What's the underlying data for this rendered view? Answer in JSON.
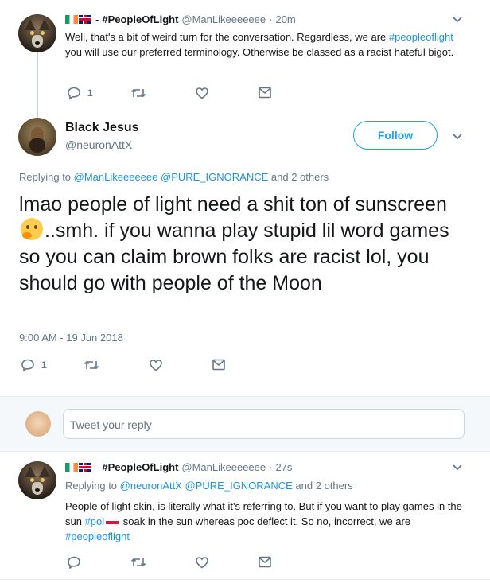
{
  "tweet1": {
    "display_name": "#PeopleOfLight",
    "handle": "@ManLikeeeeeee",
    "sep": "·",
    "time": "20m",
    "dash": "-",
    "text_plain_1": "Well, that's a bit of weird turn for the conversation. Regardless, we are ",
    "hashtag": "#peopleoflight",
    "text_plain_2": " you will use our preferred terminology. Otherwise be classed as a racist hateful bigot.",
    "reply_count": "1"
  },
  "tweet2": {
    "display_name": "Black Jesus",
    "handle": "@neuronAttX",
    "follow_label": "Follow",
    "replying_prefix": "Replying to ",
    "replying_user1": "@ManLikeeeeeee",
    "replying_user2": "@PURE_IGNORANCE",
    "replying_suffix": " and 2 others",
    "text_1": "lmao people of light need a shit ton of sunscreen ",
    "text_2": "..smh. if you wanna play stupid lil word games so you can claim brown folks are racist lol, you should go with people of the Moon",
    "timestamp": "9:00 AM - 19 Jun 2018",
    "reply_count": "1"
  },
  "reply_box": {
    "placeholder": "Tweet your reply"
  },
  "tweet3": {
    "display_name": "#PeopleOfLight",
    "handle": "@ManLikeeeeeee",
    "dash": "-",
    "time": "27s",
    "replying_prefix": "Replying to ",
    "replying_user1": "@neuronAttX",
    "replying_user2": "@PURE_IGNORANCE",
    "replying_suffix": " and 2 others",
    "text_1": "People of light skin, is literally what it's referring to. But if you want to play games in the sun ",
    "hashtag_pol": "#pol",
    "text_2": " soak in the sun whereas poc deflect it. So no, incorrect, we are ",
    "hashtag": "#peopleoflight"
  },
  "colors": {
    "link": "#1b95e0",
    "muted": "#657786",
    "text": "#14171a",
    "follow": "#1da1f2"
  },
  "icons": [
    "reply-icon",
    "retweet-icon",
    "like-icon",
    "message-icon",
    "chevron-down-icon",
    "thinking-face-emoji",
    "ireland-flag",
    "uk-flag",
    "poland-flag"
  ]
}
